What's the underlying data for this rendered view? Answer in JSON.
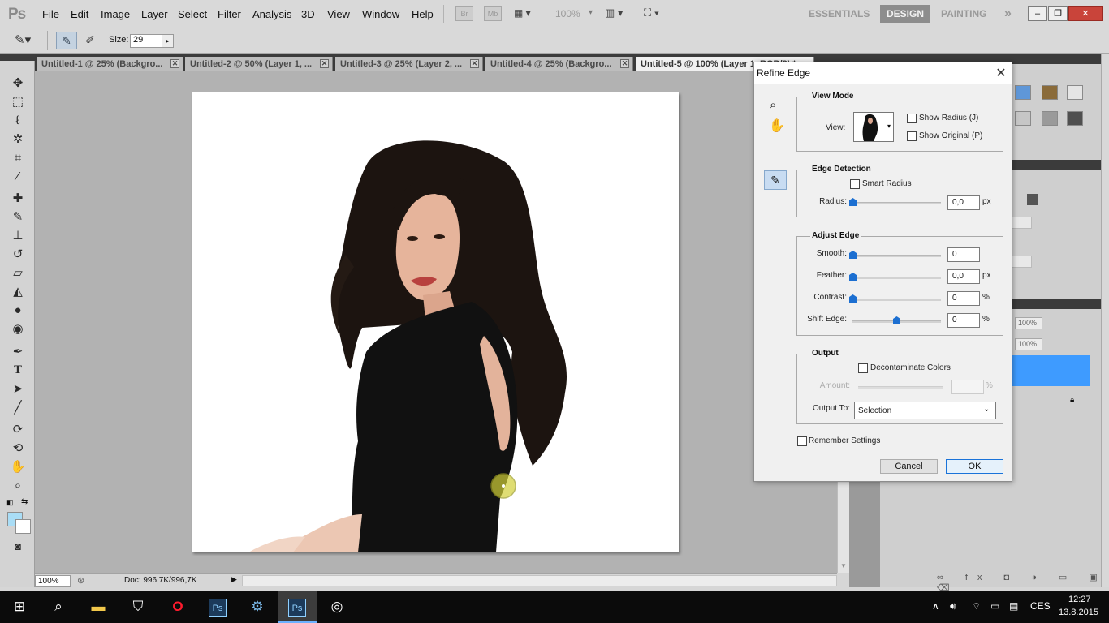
{
  "app": {
    "logo": "Ps",
    "menu": [
      "File",
      "Edit",
      "Image",
      "Layer",
      "Select",
      "Filter",
      "Analysis",
      "3D",
      "View",
      "Window",
      "Help"
    ],
    "menubar_icons": [
      "Br",
      "Mb"
    ],
    "zoom": "100%",
    "workspaces": [
      "ESSENTIALS",
      "DESIGN",
      "PAINTING"
    ],
    "more_workspaces": "»",
    "window_controls": {
      "minimize": "–",
      "restore": "❐",
      "close": "✕"
    }
  },
  "options_bar": {
    "size_label": "Size:",
    "size_value": "29"
  },
  "document_tabs": [
    "Untitled-1 @ 25% (Backgro...",
    "Untitled-2 @ 50% (Layer 1, ...",
    "Untitled-3 @ 25% (Layer 2, ...",
    "Untitled-4 @ 25% (Backgro...",
    "Untitled-5 @ 100% (Layer 1, RGB/8) *"
  ],
  "tab_close": "✕",
  "status": {
    "zoom": "100%",
    "doc": "Doc: 996,7K/996,7K"
  },
  "panels": {
    "opacity": "100%",
    "fill": "100%"
  },
  "colors": {
    "foreground": "#a9ddf6",
    "background": "#ffffff",
    "selected_layer": "#3e9bff",
    "accent": "#1a73d9"
  },
  "refine_edge": {
    "title": "Refine Edge",
    "close": "✕",
    "view_mode": {
      "title": "View Mode",
      "view_label": "View:",
      "show_radius": "Show Radius (J)",
      "show_original": "Show Original (P)"
    },
    "edge_detection": {
      "title": "Edge Detection",
      "smart_radius": "Smart Radius",
      "radius_label": "Radius:",
      "radius_value": "0,0",
      "radius_unit": "px"
    },
    "adjust_edge": {
      "title": "Adjust Edge",
      "smooth_label": "Smooth:",
      "smooth_value": "0",
      "feather_label": "Feather:",
      "feather_value": "0,0",
      "feather_unit": "px",
      "contrast_label": "Contrast:",
      "contrast_value": "0",
      "contrast_unit": "%",
      "shift_label": "Shift Edge:",
      "shift_value": "0",
      "shift_unit": "%",
      "shift_fraction": 0.5
    },
    "output": {
      "title": "Output",
      "decontaminate": "Decontaminate Colors",
      "amount_label": "Amount:",
      "amount_unit": "%",
      "output_to_label": "Output To:",
      "output_to_value": "Selection"
    },
    "remember": "Remember Settings",
    "cancel": "Cancel",
    "ok": "OK"
  },
  "taskbar": {
    "language": "CES",
    "time": "12:27",
    "date": "13.8.2015"
  }
}
